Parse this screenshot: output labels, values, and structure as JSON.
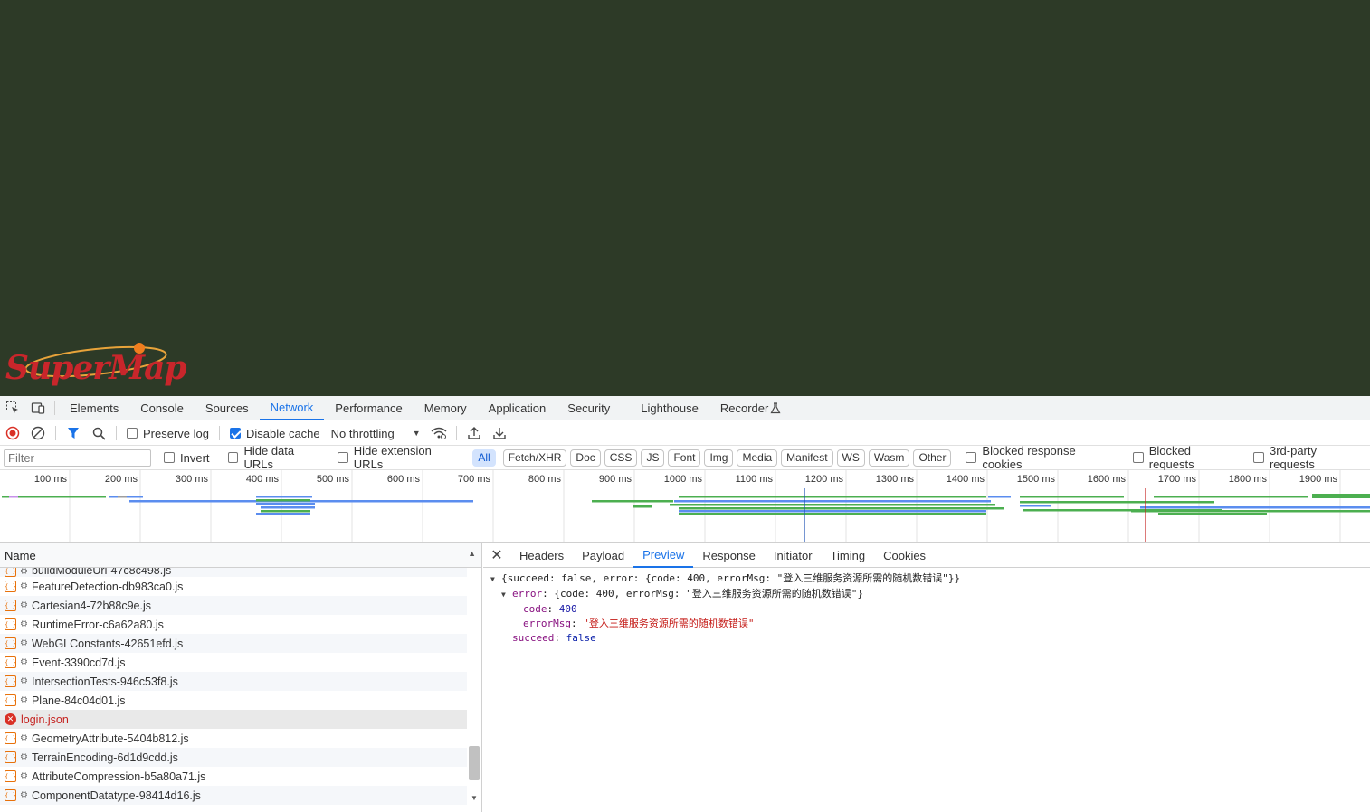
{
  "viewport": {
    "background": "#2d3a27",
    "logo_text": "SuperMap"
  },
  "devtools": {
    "main_tabs": [
      {
        "label": "Elements"
      },
      {
        "label": "Console"
      },
      {
        "label": "Sources"
      },
      {
        "label": "Network",
        "active": true
      },
      {
        "label": "Performance"
      },
      {
        "label": "Memory"
      },
      {
        "label": "Application"
      },
      {
        "label": "Security"
      },
      {
        "label": "Lighthouse"
      },
      {
        "label": "Recorder"
      }
    ],
    "toolbar": {
      "preserve_log": {
        "label": "Preserve log",
        "checked": false
      },
      "disable_cache": {
        "label": "Disable cache",
        "checked": true
      },
      "throttling": "No throttling"
    },
    "filter": {
      "placeholder": "Filter",
      "invert": "Invert",
      "hide_data_urls": "Hide data URLs",
      "hide_extension_urls": "Hide extension URLs",
      "types": [
        "All",
        "Fetch/XHR",
        "Doc",
        "CSS",
        "JS",
        "Font",
        "Img",
        "Media",
        "Manifest",
        "WS",
        "Wasm",
        "Other"
      ],
      "blocked_response_cookies": "Blocked response cookies",
      "blocked_requests": "Blocked requests",
      "third_party_requests": "3rd-party requests"
    },
    "timeline": {
      "ticks": [
        "100 ms",
        "200 ms",
        "300 ms",
        "400 ms",
        "500 ms",
        "600 ms",
        "700 ms",
        "800 ms",
        "900 ms",
        "1000 ms",
        "1100 ms",
        "1200 ms",
        "1300 ms",
        "1400 ms",
        "1500 ms",
        "1600 ms",
        "1700 ms",
        "1800 ms",
        "1900 ms"
      ]
    },
    "requests": {
      "column_name": "Name",
      "rows": [
        {
          "name": "buildModuleUrl-47c8c498.js",
          "partial": true
        },
        {
          "name": "FeatureDetection-db983ca0.js"
        },
        {
          "name": "Cartesian4-72b88c9e.js"
        },
        {
          "name": "RuntimeError-c6a62a80.js"
        },
        {
          "name": "WebGLConstants-42651efd.js"
        },
        {
          "name": "Event-3390cd7d.js"
        },
        {
          "name": "IntersectionTests-946c53f8.js"
        },
        {
          "name": "Plane-84c04d01.js"
        },
        {
          "name": "login.json",
          "error": true
        },
        {
          "name": "GeometryAttribute-5404b812.js"
        },
        {
          "name": "TerrainEncoding-6d1d9cdd.js"
        },
        {
          "name": "AttributeCompression-b5a80a71.js"
        },
        {
          "name": "ComponentDatatype-98414d16.js"
        }
      ]
    },
    "detail": {
      "tabs": [
        "Headers",
        "Payload",
        "Preview",
        "Response",
        "Initiator",
        "Timing",
        "Cookies"
      ],
      "active_tab": "Preview",
      "preview": {
        "root_summary": "{succeed: false, error: {code: 400, errorMsg: \"登入三维服务资源所需的随机数错误\"}}",
        "error_summary": "{code: 400, errorMsg: \"登入三维服务资源所需的随机数错误\"}",
        "error_key": "error",
        "code_key": "code",
        "code_value": "400",
        "errormsg_key": "errorMsg",
        "errormsg_value": "\"登入三维服务资源所需的随机数错误\"",
        "succeed_key": "succeed",
        "succeed_value": "false"
      }
    }
  }
}
